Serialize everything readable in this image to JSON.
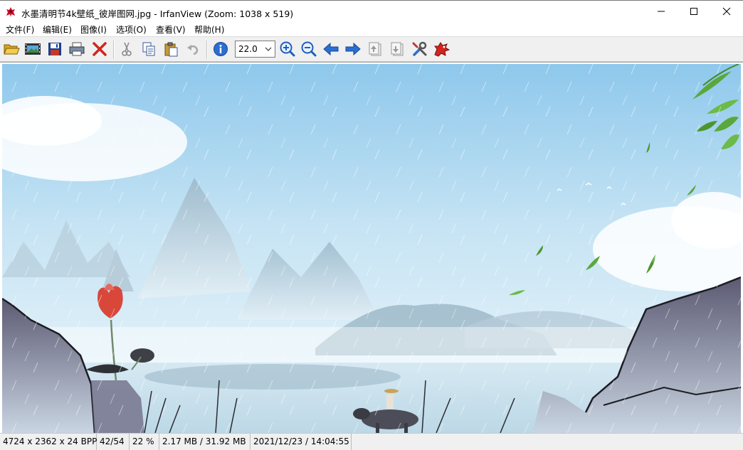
{
  "window": {
    "title": "水墨清明节4k壁纸_彼岸图网.jpg - IrfanView (Zoom: 1038 x 519)",
    "controls": [
      "minimize-icon",
      "maximize-icon",
      "close-icon"
    ]
  },
  "menu": {
    "items": [
      {
        "label": "文件(F)"
      },
      {
        "label": "编辑(E)"
      },
      {
        "label": "图像(I)"
      },
      {
        "label": "选项(O)"
      },
      {
        "label": "查看(V)"
      },
      {
        "label": "帮助(H)"
      }
    ]
  },
  "toolbar": {
    "buttons": [
      {
        "icon": "open-folder-icon"
      },
      {
        "icon": "slideshow-icon"
      },
      {
        "icon": "save-icon"
      },
      {
        "icon": "print-icon"
      },
      {
        "icon": "delete-icon"
      },
      {
        "icon": "cut-icon"
      },
      {
        "icon": "copy-icon"
      },
      {
        "icon": "paste-icon"
      },
      {
        "icon": "undo-icon"
      },
      {
        "icon": "info-icon"
      },
      {
        "icon": "zoom-in-icon"
      },
      {
        "icon": "zoom-out-icon"
      },
      {
        "icon": "previous-icon"
      },
      {
        "icon": "next-icon"
      },
      {
        "icon": "first-file-icon"
      },
      {
        "icon": "last-file-icon"
      },
      {
        "icon": "settings-icon"
      },
      {
        "icon": "irfanview-logo-icon"
      }
    ],
    "zoom_value": "22.0"
  },
  "image": {
    "description_name": "ink-landscape-wallpaper",
    "colors": {
      "sky_top": "#8ec8ec",
      "sky_bottom": "#dbeef8",
      "mountain": "#a9c4d3",
      "water": "#cfe4ef",
      "rock": "#5e5f78",
      "lotus": "#d9473b",
      "leaf": "#5aa83a"
    }
  },
  "status": {
    "dimensions": "4724 x 2362 x 24 BPP",
    "file_index": "42/54",
    "zoom_percent": "22 %",
    "file_size": "2.17 MB / 31.92 MB",
    "datetime": "2021/12/23 / 14:04:55"
  }
}
